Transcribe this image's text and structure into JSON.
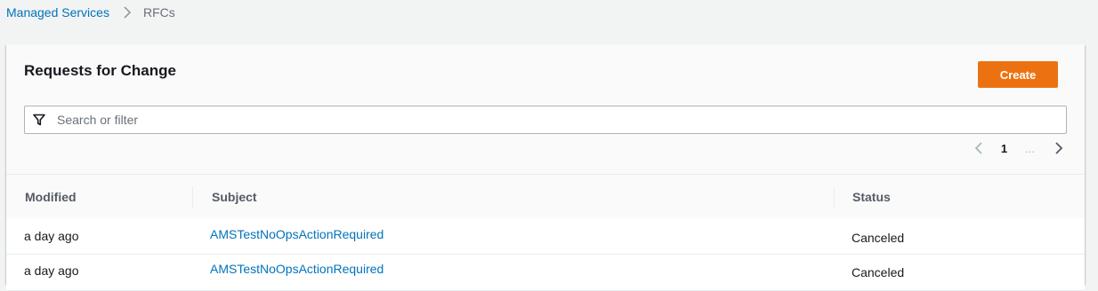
{
  "breadcrumb": {
    "root": "Managed Services",
    "current": "RFCs"
  },
  "panel": {
    "title": "Requests for Change",
    "create_label": "Create"
  },
  "search": {
    "placeholder": "Search or filter",
    "value": ""
  },
  "pagination": {
    "current_page": "1",
    "ellipsis": "..."
  },
  "table": {
    "columns": [
      "Modified",
      "Subject",
      "Status"
    ],
    "rows": [
      {
        "modified": "a day ago",
        "subject": "AMSTestNoOpsActionRequired",
        "status": "Canceled"
      },
      {
        "modified": "a day ago",
        "subject": "AMSTestNoOpsActionRequired",
        "status": "Canceled"
      }
    ]
  },
  "colors": {
    "accent": "#ec7211",
    "link": "#0073bb",
    "background": "#f2f3f3"
  }
}
